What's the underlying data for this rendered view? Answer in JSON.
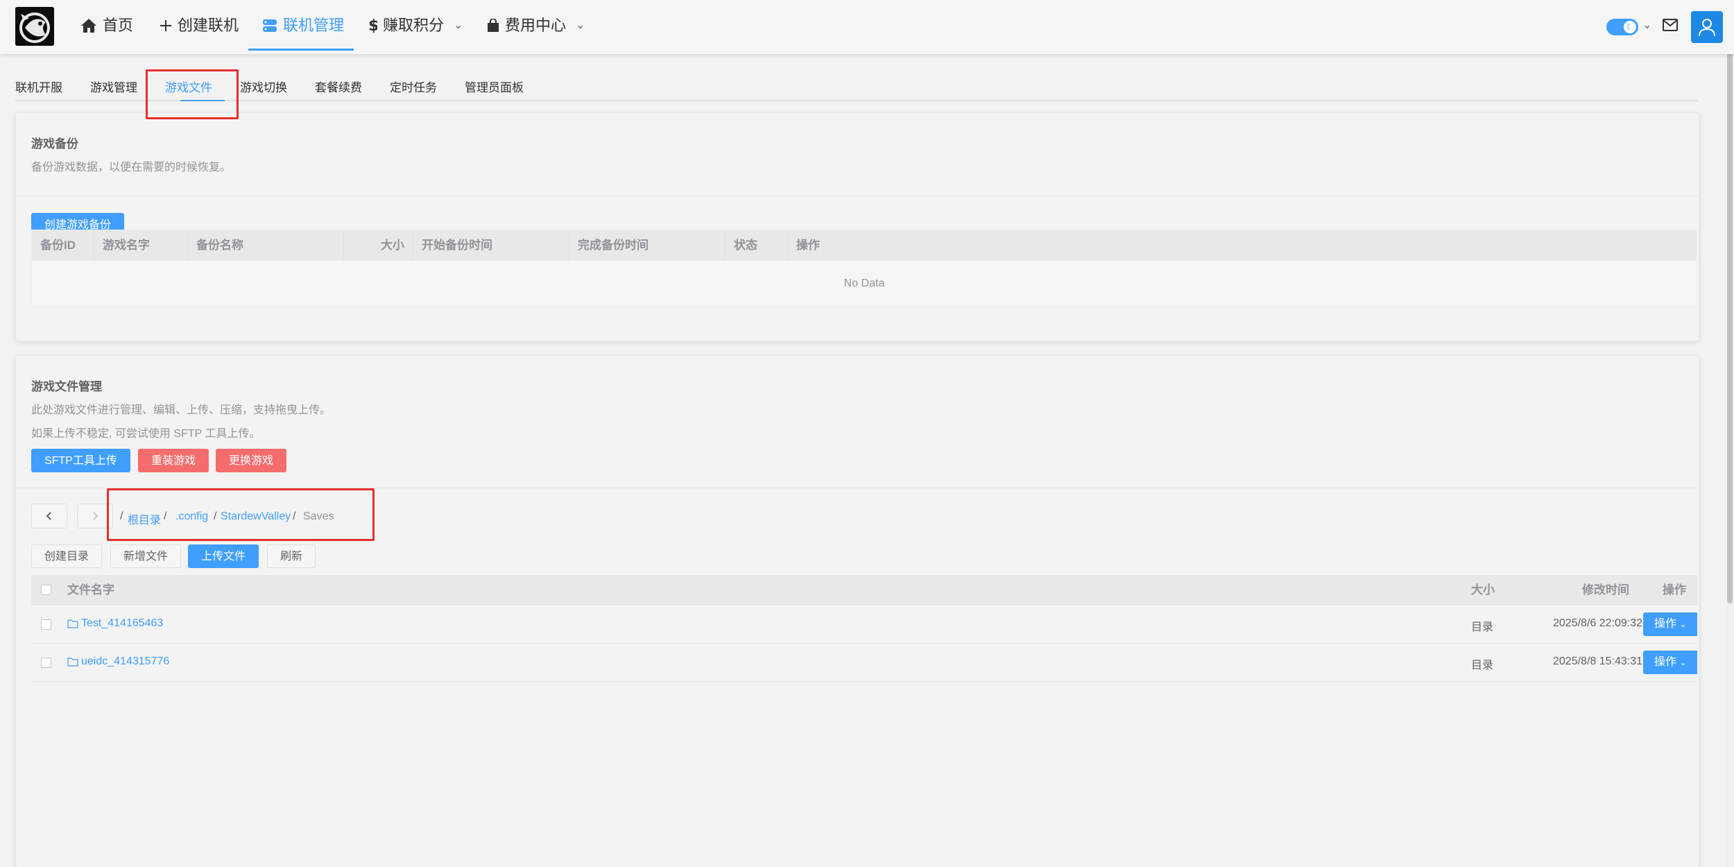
{
  "nav": {
    "home": "首页",
    "create": "创建联机",
    "manage": "联机管理",
    "earn": "赚取积分",
    "fees": "费用中心"
  },
  "tabs": [
    "联机开服",
    "游戏管理",
    "游戏文件",
    "游戏切换",
    "套餐续费",
    "定时任务",
    "管理员面板"
  ],
  "backup": {
    "title": "游戏备份",
    "desc": "备份游戏数据，以便在需要的时候恢复。",
    "create_btn": "创建游戏备份",
    "columns": [
      "备份ID",
      "游戏名字",
      "备份名称",
      "大小",
      "开始备份时间",
      "完成备份时间",
      "状态",
      "操作"
    ],
    "empty": "No Data"
  },
  "files": {
    "title": "游戏文件管理",
    "desc1": "此处游戏文件进行管理、编辑、上传、压缩，支持拖曳上传。",
    "desc2": "如果上传不稳定, 可尝试使用 SFTP 工具上传。",
    "btn_sftp": "SFTP工具上传",
    "btn_reinstall": "重装游戏",
    "btn_change": "更换游戏",
    "breadcrumb": [
      "根目录",
      ".config",
      "StardewValley",
      "Saves"
    ],
    "btn_mkdir": "创建目录",
    "btn_newfile": "新增文件",
    "btn_upload": "上传文件",
    "btn_refresh": "刷新",
    "col_name": "文件名字",
    "col_size": "大小",
    "col_mtime": "修改时间",
    "col_op": "操作",
    "rows": [
      {
        "name": "Test_414165463",
        "size": "目录",
        "mtime": "2025/8/6 22:09:32",
        "op": "操作"
      },
      {
        "name": "ueidc_414315776",
        "size": "目录",
        "mtime": "2025/8/8 15:43:31",
        "op": "操作"
      }
    ]
  },
  "colors": {
    "accent": "#409eff",
    "danger": "#f56c6c",
    "highlight": "#e62e2e"
  }
}
